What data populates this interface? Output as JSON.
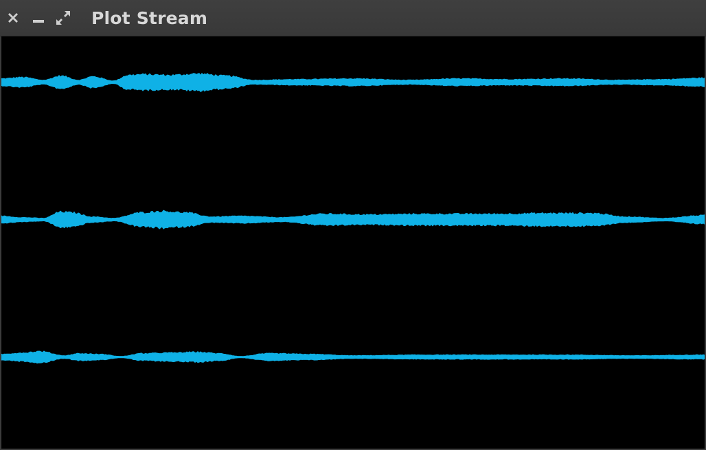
{
  "window": {
    "title": "Plot Stream",
    "controls": {
      "close_icon": "close-icon",
      "minimize_icon": "minimize-icon",
      "maximize_icon": "maximize-icon"
    }
  },
  "colors": {
    "titlebar": "#3c3c3c",
    "title_text": "#d8d8d8",
    "plot_background": "#000000",
    "signal": "#0fb1e6",
    "control_icon": "#cfcfcf"
  },
  "chart_data": {
    "type": "area",
    "series": [
      {
        "x": [
          0,
          0.03,
          0.06,
          0.085,
          0.11,
          0.13,
          0.16,
          0.18,
          0.2,
          0.24,
          0.28,
          0.32,
          0.36,
          0.42,
          0.5,
          0.58,
          0.65,
          0.72,
          0.8,
          0.88,
          0.94,
          1.0
        ],
        "amplitude": [
          5,
          7,
          3,
          9,
          3,
          8,
          2,
          10,
          11,
          10,
          12,
          9,
          3,
          4,
          5,
          3,
          5,
          4,
          5,
          3,
          4,
          6
        ]
      },
      {
        "x": [
          0,
          0.03,
          0.06,
          0.085,
          0.1,
          0.13,
          0.16,
          0.2,
          0.23,
          0.26,
          0.3,
          0.34,
          0.4,
          0.46,
          0.52,
          0.6,
          0.7,
          0.78,
          0.84,
          0.89,
          0.94,
          1.0
        ],
        "amplitude": [
          5,
          3,
          2,
          11,
          10,
          4,
          2,
          10,
          12,
          10,
          4,
          5,
          3,
          8,
          7,
          8,
          8,
          9,
          9,
          4,
          2,
          6
        ]
      },
      {
        "x": [
          0,
          0.03,
          0.055,
          0.09,
          0.11,
          0.14,
          0.17,
          0.2,
          0.24,
          0.28,
          0.31,
          0.34,
          0.38,
          0.44,
          0.5,
          0.6,
          0.7,
          0.8,
          0.9,
          1.0
        ],
        "amplitude": [
          4,
          6,
          8,
          2,
          5,
          4,
          1,
          5,
          6,
          7,
          5,
          1,
          5,
          4,
          2,
          3,
          3,
          3,
          2,
          3
        ]
      }
    ]
  }
}
